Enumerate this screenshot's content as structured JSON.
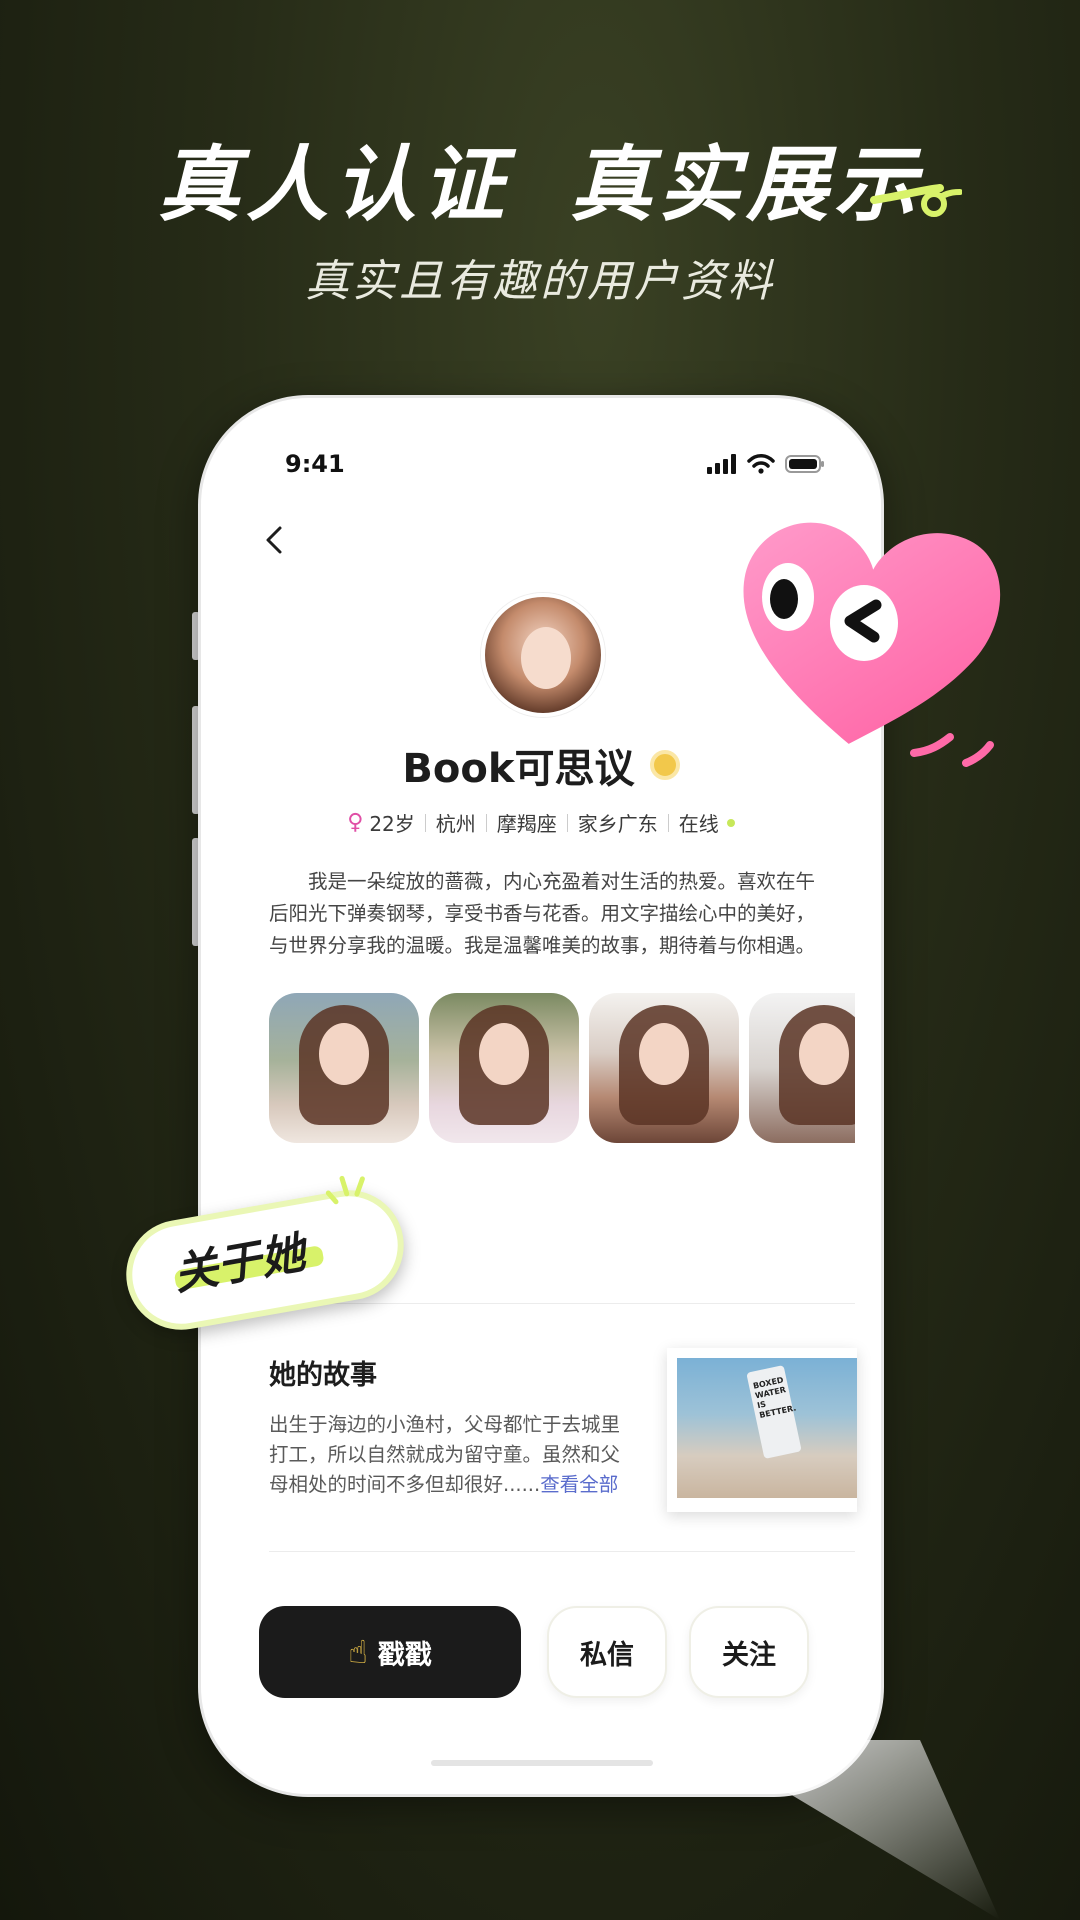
{
  "promo": {
    "headline_part1": "真人认证",
    "headline_part2": "真实展示",
    "subheadline": "真实且有趣的用户资料"
  },
  "status_bar": {
    "time": "9:41"
  },
  "profile": {
    "name": "Book可思议",
    "gender_symbol": "♀",
    "age": "22岁",
    "city": "杭州",
    "zodiac": "摩羯座",
    "hometown": "家乡广东",
    "online_status": "在线",
    "bio": "我是一朵绽放的蔷薇，内心充盈着对生活的热爱。喜欢在午后阳光下弹奏钢琴，享受书香与花香。用文字描绘心中的美好，与世界分享我的温暖。我是温馨唯美的故事，期待着与你相遇。"
  },
  "about_sticker": "关于她",
  "story": {
    "title": "她的故事",
    "text": "出生于海边的小渔村，父母都忙于去城里打工，所以自然就成为留守童。虽然和父母相处的时间不多但却很好......",
    "more_link": "查看全部",
    "photo_caption": "BOXED WATER IS BETTER."
  },
  "actions": {
    "poke_icon": "☝",
    "poke_label": "戳戳",
    "message_label": "私信",
    "follow_label": "关注"
  },
  "colors": {
    "accent_lime": "#d8f26a",
    "heart_pink": "#ff7fb6",
    "link_blue": "#5a6ccc",
    "online_green": "#c7e85a"
  }
}
